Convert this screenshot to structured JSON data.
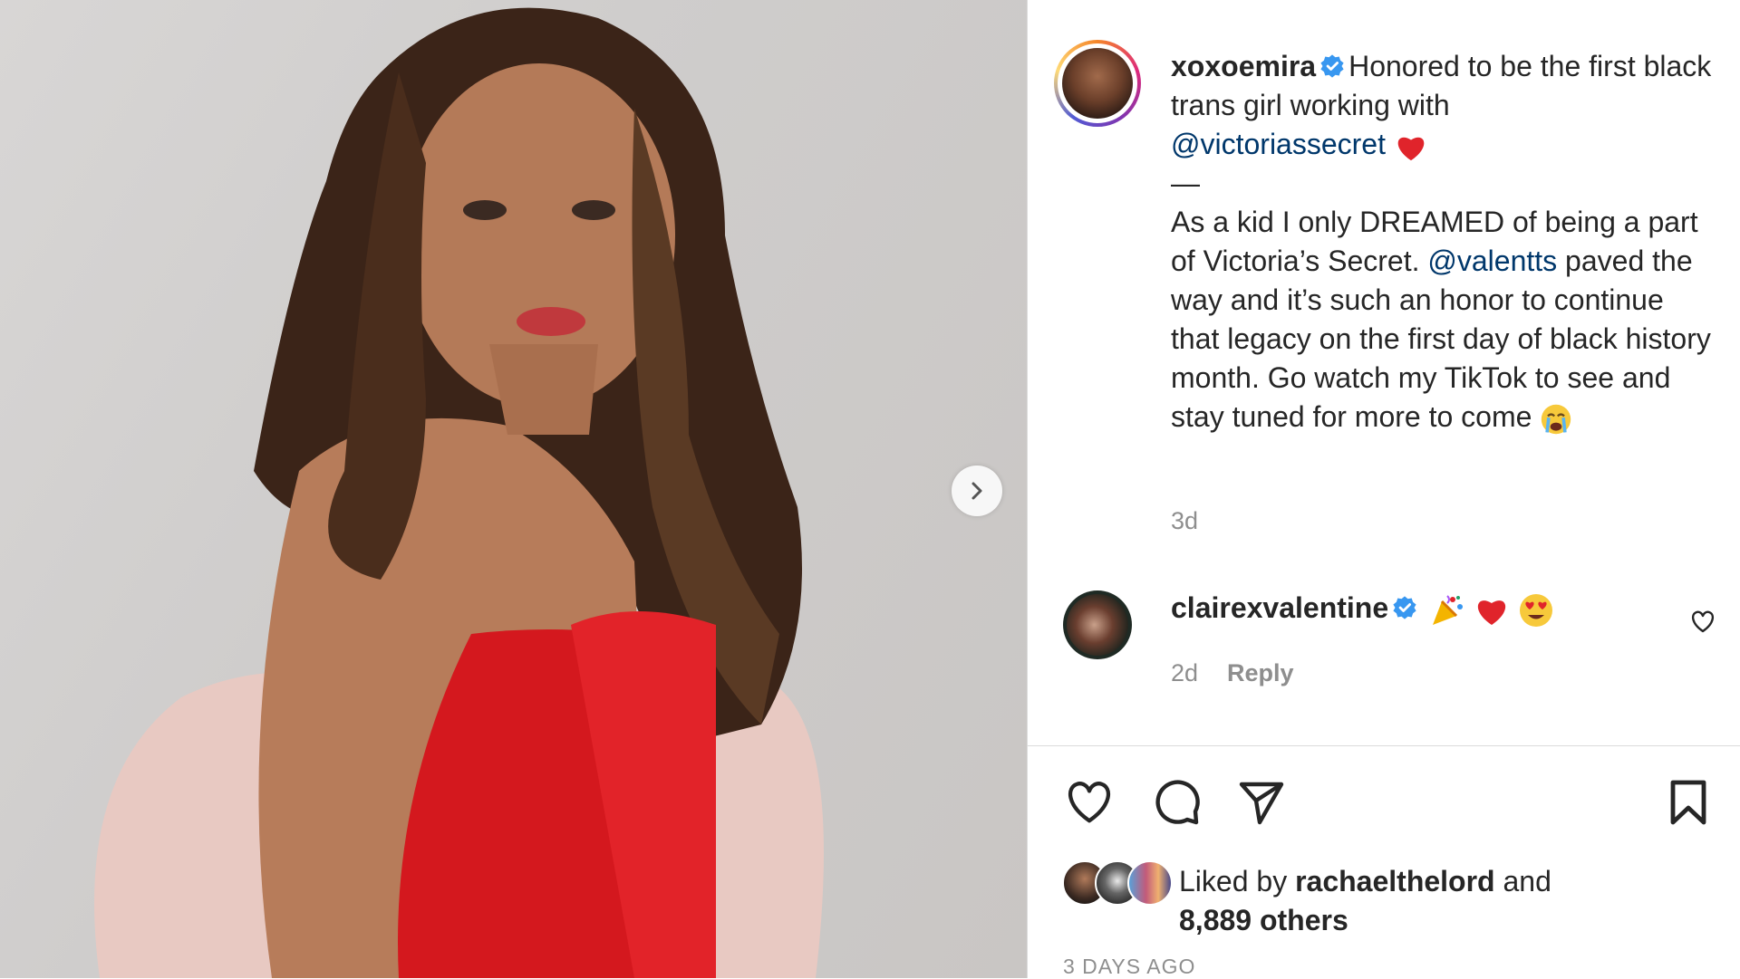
{
  "post": {
    "author": "xoxoemira",
    "caption_line1": "Honored to be the first black trans girl working with",
    "caption_mention1": "@victoriassecret",
    "caption_dash": "—",
    "caption_part2a": "As a kid I only DREAMED of being a part of Victoria’s Secret.",
    "caption_mention2": "@valentts",
    "caption_part2b": "paved the way and it’s such an honor to continue that legacy on the first day of black history month. Go watch my TikTok to see and stay tuned for more to come",
    "caption_time": "3d"
  },
  "comment": {
    "author": "clairexvalentine",
    "time": "2d",
    "reply_label": "Reply"
  },
  "likes": {
    "prefix": "Liked by",
    "user": "rachaelthelord",
    "and": "and",
    "others": "8,889 others"
  },
  "date_label": "3 DAYS AGO",
  "icons": {
    "next": "chevron-right-icon",
    "verified": "verified-badge-icon",
    "like": "heart-icon",
    "comment": "comment-icon",
    "share": "paper-plane-icon",
    "save": "bookmark-icon"
  },
  "colors": {
    "verified": "#3897f0",
    "mention": "#00376b",
    "muted": "#8e8e8e"
  }
}
